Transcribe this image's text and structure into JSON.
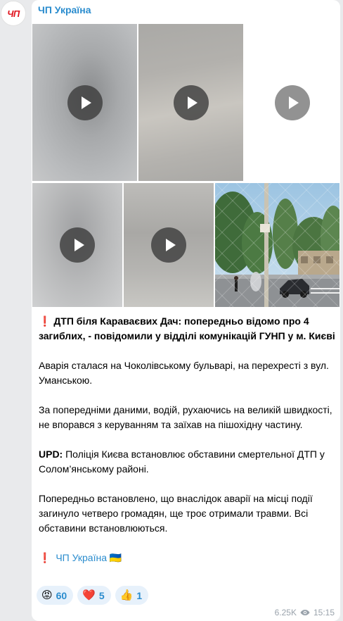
{
  "channel": {
    "avatar_text": "ЧП",
    "name": "ЧП Україна"
  },
  "media": {
    "tiles": [
      {
        "kind": "video"
      },
      {
        "kind": "video"
      },
      {
        "kind": "video"
      },
      {
        "kind": "video"
      },
      {
        "kind": "video"
      },
      {
        "kind": "photo"
      }
    ]
  },
  "post": {
    "headline_mark": "❗",
    "headline": "ДТП біля Караваєвих Дач: попередньо відомо про 4 загиблих, - повідомили у відділі комунікацій ГУНП у м. Києві",
    "p1": "Аварія сталася на Чоколівському бульварі, на перехресті з вул. Уманською.",
    "p2": "За попередніми даними, водій, рухаючись на великій швидкості, не впорався з керуванням та заїхав на пішохідну частину.",
    "upd_label": "UPD:",
    "upd_text": " Поліція Києва встановлює обставини смертельної ДТП у Солом’янському районі.",
    "p4": "Попередньо встановлено, що внаслідок аварії на місці події загинуло четверо громадян, ще троє отримали травми. Всі обставини встановлюються.",
    "footer_mark": "❗",
    "footer_channel": "ЧП Україна",
    "footer_flag": "🇺🇦"
  },
  "reactions": [
    {
      "emoji": "😡",
      "count": "60"
    },
    {
      "emoji": "❤️",
      "count": "5"
    },
    {
      "emoji": "👍",
      "count": "1"
    }
  ],
  "meta": {
    "views": "6.25K",
    "time": "15:15"
  },
  "colors": {
    "accent": "#2a8cce",
    "alert": "#e0141e",
    "bubble": "#ffffff",
    "background": "#e9eaec"
  }
}
